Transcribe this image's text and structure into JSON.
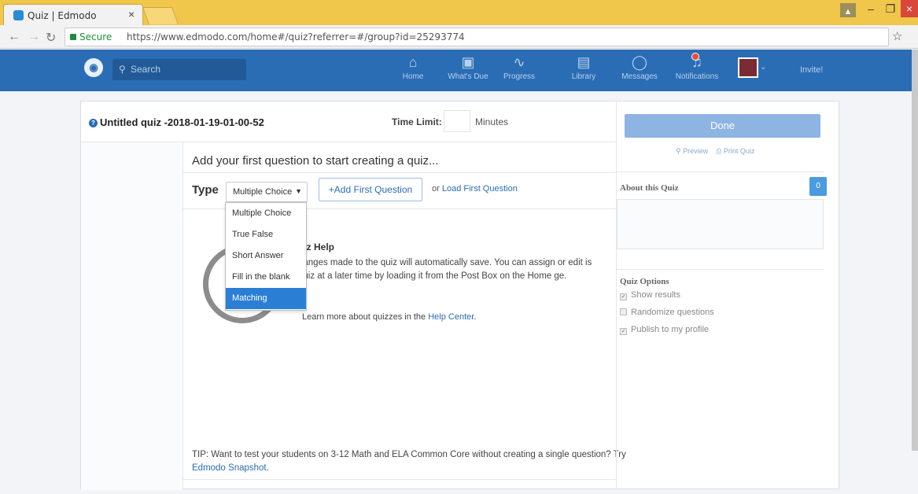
{
  "browser": {
    "tab_title": "Quiz | Edmodo",
    "tab_close": "×",
    "secure_label": "Secure",
    "url": "https://www.edmodo.com/home#/quiz?referrer=#/group?id=25293774"
  },
  "appnav": {
    "search_placeholder": "Search",
    "items": [
      {
        "label": "Home",
        "icon": "home-icon"
      },
      {
        "label": "What's Due",
        "icon": "calendar-icon"
      },
      {
        "label": "Progress",
        "icon": "progress-icon"
      },
      {
        "label": "Library",
        "icon": "library-icon"
      },
      {
        "label": "Messages",
        "icon": "message-icon"
      },
      {
        "label": "Notifications",
        "icon": "bell-icon"
      }
    ],
    "invite_label": "Invite!"
  },
  "quiz": {
    "title": "Untitled quiz -2018-01-19-01-00-52",
    "time_limit_label": "Time Limit:",
    "time_limit_value": "",
    "minutes_label": "Minutes",
    "add_first_prompt": "Add your first question to start creating a quiz...",
    "type_label": "Type",
    "type_selected": "Multiple Choice",
    "add_first_button": "+Add First Question",
    "or_label": "or",
    "load_first_link": "Load First Question",
    "type_options": [
      "Multiple Choice",
      "True False",
      "Short Answer",
      "Fill in the blank",
      "Matching"
    ],
    "highlighted_option": "Matching"
  },
  "help": {
    "title": "uiz Help",
    "text": "hanges made to the quiz will automatically save. You can assign or edit is quiz at a later time by loading it from the Post Box on the Home ge.",
    "more_prefix": "Learn more about quizzes in the",
    "more_link": "Help Center",
    "more_suffix": "."
  },
  "tip": {
    "prefix": "TIP: Want to test your students on 3-12 Math and ELA Common Core without creating a single question? Try",
    "link": "Edmodo Snapshot",
    "suffix": "."
  },
  "sidebar": {
    "done_button": "Done",
    "preview_link": "Preview",
    "print_link": "Print Quiz",
    "about_title": "About this Quiz",
    "about_count": "0",
    "options_title": "Quiz Options",
    "options": [
      {
        "label": "Show results",
        "checked": true
      },
      {
        "label": "Randomize questions",
        "checked": false
      },
      {
        "label": "Publish to my profile",
        "checked": true
      }
    ]
  },
  "colors": {
    "brand_blue": "#2a6db5",
    "done_button": "#8db4e2",
    "dropdown_highlight": "#2a7fd4",
    "tabstrip": "#f0c64b"
  }
}
